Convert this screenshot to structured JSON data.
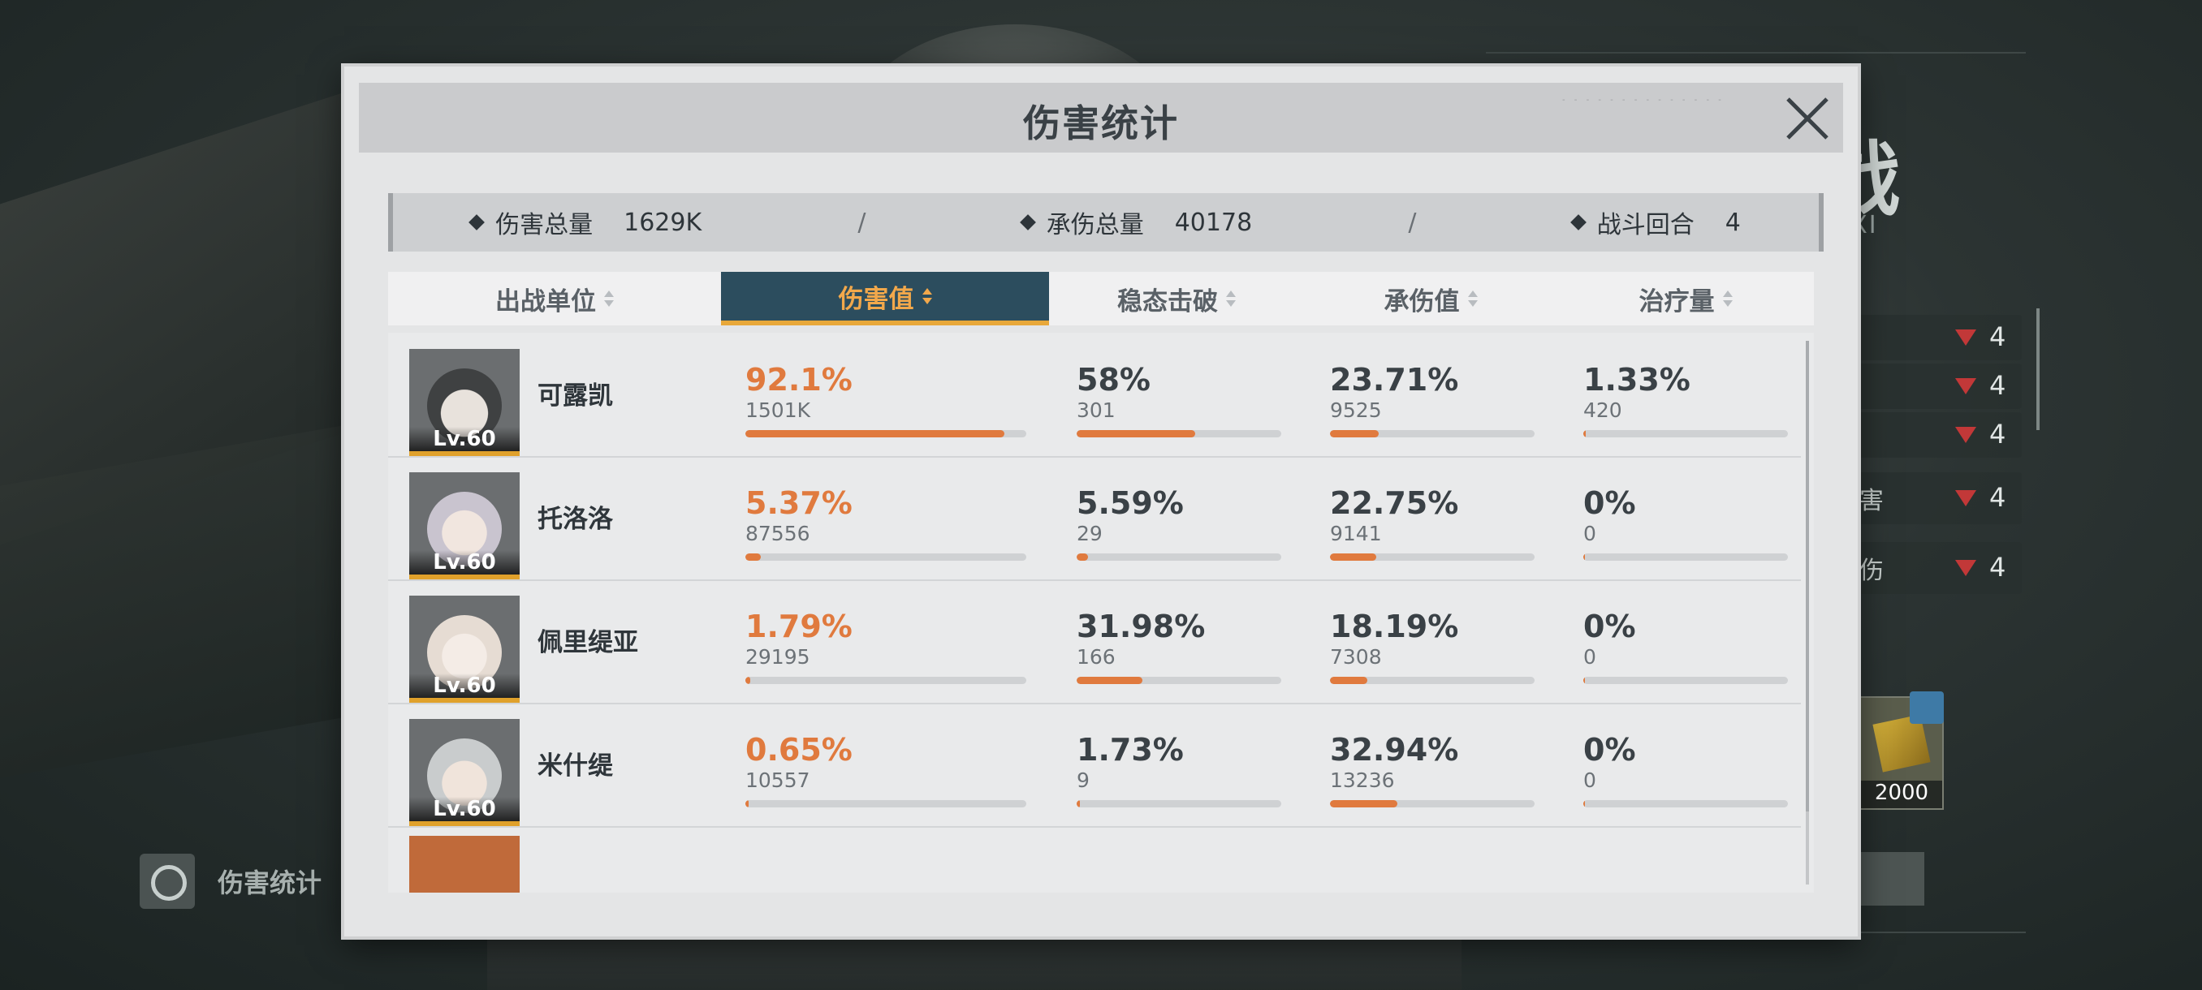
{
  "modal": {
    "title": "伤害统计"
  },
  "summary": {
    "total_damage_label": "伤害总量",
    "total_damage_value": "1629K",
    "total_taken_label": "承伤总量",
    "total_taken_value": "40178",
    "rounds_label": "战斗回合",
    "rounds_value": "4",
    "separator": "/"
  },
  "tabs": [
    {
      "label": "出战单位",
      "active": false
    },
    {
      "label": "伤害值",
      "active": true
    },
    {
      "label": "稳态击破",
      "active": false
    },
    {
      "label": "承伤值",
      "active": false
    },
    {
      "label": "治疗量",
      "active": false
    }
  ],
  "rows": [
    {
      "name": "可露凯",
      "level": "Lv.60",
      "damage_pct": "92.1%",
      "damage_raw": "1501K",
      "damage_frac": 0.921,
      "break_pct": "58%",
      "break_raw": "301",
      "break_frac": 0.58,
      "taken_pct": "23.71%",
      "taken_raw": "9525",
      "taken_frac": 0.2371,
      "heal_pct": "1.33%",
      "heal_raw": "420",
      "heal_frac": 0.0133
    },
    {
      "name": "托洛洛",
      "level": "Lv.60",
      "damage_pct": "5.37%",
      "damage_raw": "87556",
      "damage_frac": 0.0537,
      "break_pct": "5.59%",
      "break_raw": "29",
      "break_frac": 0.0559,
      "taken_pct": "22.75%",
      "taken_raw": "9141",
      "taken_frac": 0.2275,
      "heal_pct": "0%",
      "heal_raw": "0",
      "heal_frac": 0
    },
    {
      "name": "佩里缇亚",
      "level": "Lv.60",
      "damage_pct": "1.79%",
      "damage_raw": "29195",
      "damage_frac": 0.0179,
      "break_pct": "31.98%",
      "break_raw": "166",
      "break_frac": 0.3198,
      "taken_pct": "18.19%",
      "taken_raw": "7308",
      "taken_frac": 0.1819,
      "heal_pct": "0%",
      "heal_raw": "0",
      "heal_frac": 0
    },
    {
      "name": "米什缇",
      "level": "Lv.60",
      "damage_pct": "0.65%",
      "damage_raw": "10557",
      "damage_frac": 0.0065,
      "break_pct": "1.73%",
      "break_raw": "9",
      "break_frac": 0.0173,
      "taken_pct": "32.94%",
      "taken_raw": "13236",
      "taken_frac": 0.3294,
      "heal_pct": "0%",
      "heal_raw": "0",
      "heal_frac": 0
    }
  ],
  "background": {
    "side_title": "战",
    "side_subtitle": "FXI",
    "side_rows": [
      {
        "label": "",
        "value": "4"
      },
      {
        "label": "",
        "value": "4"
      },
      {
        "label": "",
        "value": "4"
      },
      {
        "label": "伤害",
        "value": "4"
      },
      {
        "label": "态伤",
        "value": "4"
      }
    ],
    "card_count": "2000",
    "bottom_left_label": "伤害统计"
  },
  "colors": {
    "accent_orange": "#e07a3e",
    "active_tab_bg": "#2c4d5e",
    "active_tab_text": "#f2a84b",
    "level_underline": "#e0a12b"
  }
}
